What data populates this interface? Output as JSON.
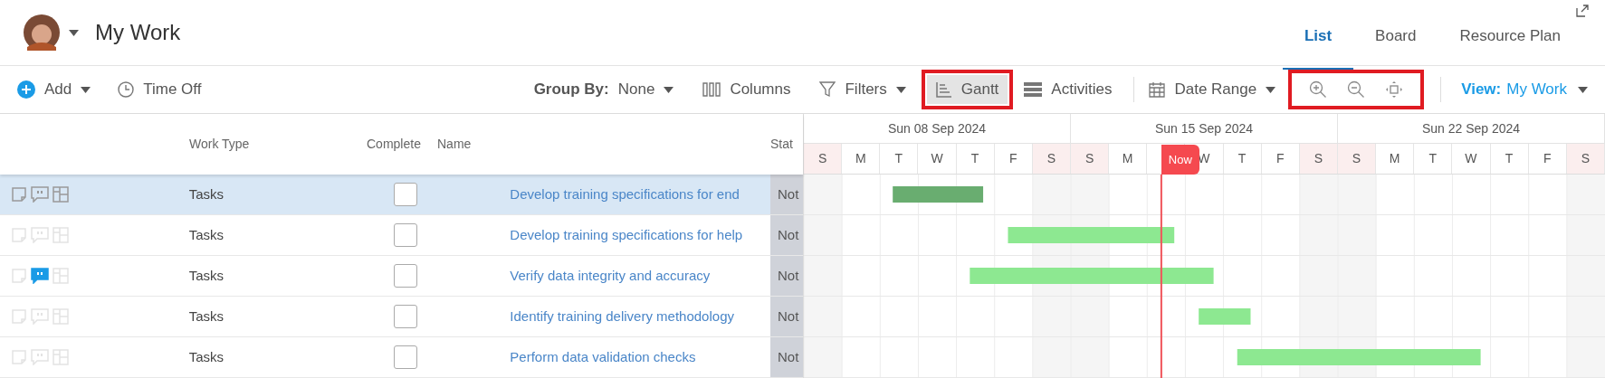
{
  "header": {
    "title": "My Work",
    "tabs": [
      {
        "label": "List",
        "selected": true
      },
      {
        "label": "Board",
        "selected": false
      },
      {
        "label": "Resource Plan",
        "selected": false
      }
    ]
  },
  "toolbar": {
    "add": "Add",
    "time_off": "Time Off",
    "group_by": {
      "label": "Group By:",
      "value": "None"
    },
    "columns": "Columns",
    "filters": "Filters",
    "gantt": {
      "label": "Gantt",
      "selected": true
    },
    "activities": "Activities",
    "date_range": "Date Range",
    "view": {
      "label": "View:",
      "value": "My Work"
    }
  },
  "table": {
    "columns": [
      "Work Type",
      "Complete",
      "Name",
      "Stat"
    ],
    "rows": [
      {
        "selected": true,
        "has_comments": false,
        "work_type": "Tasks",
        "complete": false,
        "name": "Develop training specifications for end",
        "status": "Not"
      },
      {
        "selected": false,
        "has_comments": false,
        "work_type": "Tasks",
        "complete": false,
        "name": "Develop training specifications for help",
        "status": "Not"
      },
      {
        "selected": false,
        "has_comments": true,
        "work_type": "Tasks",
        "complete": false,
        "name": "Verify data integrity and accuracy",
        "status": "Not"
      },
      {
        "selected": false,
        "has_comments": false,
        "work_type": "Tasks",
        "complete": false,
        "name": "Identify training delivery methodology",
        "status": "Not"
      },
      {
        "selected": false,
        "has_comments": false,
        "work_type": "Tasks",
        "complete": false,
        "name": "Perform data validation checks",
        "status": "Not"
      }
    ]
  },
  "gantt": {
    "weeks": [
      {
        "label": "Sun 08 Sep 2024",
        "days": [
          {
            "label": "S",
            "weekend": true
          },
          {
            "label": "M",
            "weekend": false
          },
          {
            "label": "T",
            "weekend": false
          },
          {
            "label": "W",
            "weekend": false
          },
          {
            "label": "T",
            "weekend": false
          },
          {
            "label": "F",
            "weekend": false
          },
          {
            "label": "S",
            "weekend": true
          }
        ]
      },
      {
        "label": "Sun 15 Sep 2024",
        "days": [
          {
            "label": "S",
            "weekend": true
          },
          {
            "label": "M",
            "weekend": false
          },
          {
            "weekend": false
          },
          {
            "label": "W",
            "weekend": false
          },
          {
            "label": "T",
            "weekend": false
          },
          {
            "label": "F",
            "weekend": false
          },
          {
            "label": "S",
            "weekend": true
          }
        ]
      },
      {
        "label": "Sun 22 Sep 2024",
        "days": [
          {
            "label": "S",
            "weekend": true
          },
          {
            "label": "M",
            "weekend": false
          },
          {
            "label": "T",
            "weekend": false
          },
          {
            "label": "W",
            "weekend": false
          },
          {
            "label": "T",
            "weekend": false
          },
          {
            "label": "F",
            "weekend": false
          },
          {
            "label": "S",
            "weekend": true
          }
        ]
      }
    ],
    "now_label": "Now"
  }
}
